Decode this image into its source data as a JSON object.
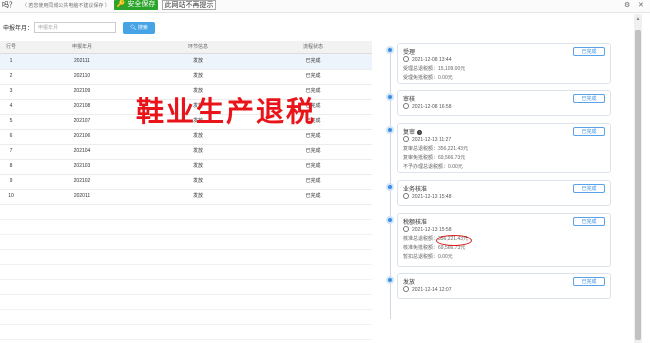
{
  "topbar": {
    "question": "吗？",
    "warning": "（ 若您使用同城公共电脑不建议保存 ）",
    "save_label": "安全保存",
    "no_prompt_label": "此网站不再提示",
    "icons": [
      "gear-icon",
      "close-icon"
    ]
  },
  "search": {
    "label": "申报年月：",
    "placeholder": "申报年月",
    "button_label": "搜索"
  },
  "table": {
    "headers": [
      "行号",
      "申报年月",
      "环节信息",
      "流程状态"
    ],
    "rows": [
      [
        "1",
        "202111",
        "发放",
        "已完成"
      ],
      [
        "2",
        "202110",
        "发放",
        "已完成"
      ],
      [
        "3",
        "202109",
        "发放",
        "已完成"
      ],
      [
        "4",
        "202108",
        "发放",
        "已完成"
      ],
      [
        "5",
        "202107",
        "发放",
        "已完成"
      ],
      [
        "6",
        "202106",
        "发放",
        "已完成"
      ],
      [
        "7",
        "202104",
        "发放",
        "已完成"
      ],
      [
        "8",
        "202103",
        "发放",
        "已完成"
      ],
      [
        "9",
        "202102",
        "发放",
        "已完成"
      ],
      [
        "10",
        "202011",
        "发放",
        "已完成"
      ]
    ]
  },
  "watermark": "鞋业生产退税",
  "timeline": {
    "done_label": "已完成",
    "steps": [
      {
        "title": "受理",
        "time": "2021-12-08 13:44",
        "lines": [
          "受理总退税额：15,109.00元",
          "受理免抵税额：0.00元"
        ]
      },
      {
        "title": "审核",
        "time": "2021-12-08 16:58",
        "lines": []
      },
      {
        "title": "复审",
        "time": "2021-12-13 11:27",
        "lines": [
          "复审总退税额：356,221.43元",
          "复审免抵税额：69,566.73元",
          "不予办理总退税额：0.00元"
        ]
      },
      {
        "title": "业务核准",
        "time": "2021-12-13 15:48",
        "lines": []
      },
      {
        "title": "税额核准",
        "time": "2021-12-13 15:58",
        "lines": [
          "核准总退税额：356,221.43元",
          "核准免抵税额：69,566.73元",
          "暂扣总退税额：0.00元"
        ]
      },
      {
        "title": "发放",
        "time": "2021-12-14 12:07",
        "lines": []
      }
    ]
  },
  "colors": {
    "accent": "#3a8ee6",
    "save_green": "#2aa52a",
    "watermark_red": "#e8141a"
  }
}
